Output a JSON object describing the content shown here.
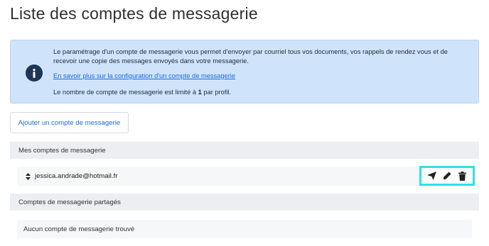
{
  "page": {
    "title": "Liste des comptes de messagerie"
  },
  "info": {
    "description": "Le paramétrage d'un compte de messagerie vous permet d'envoyer par courriel tous vos documents, vos rappels de rendez vous et de recevoir une copie des messages envoyés dans votre messagerie.",
    "link_label": "En savoir plus sur la configuration d'un compte de messagerie",
    "limit_prefix": "Le nombre de compte de messagerie est limité à ",
    "limit_value": "1",
    "limit_suffix": " par profil.",
    "icon": "info-circle-icon"
  },
  "add_button": {
    "label": "Ajouter un compte de messagerie"
  },
  "my_accounts": {
    "header": "Mes comptes de messagerie",
    "items": [
      {
        "email": "jessica.andrade@hotmail.fr",
        "actions": [
          "send-icon",
          "pencil-icon",
          "trash-icon"
        ]
      }
    ]
  },
  "shared_accounts": {
    "header": "Comptes de messagerie partagés",
    "empty_text": "Aucun compte de messagerie trouvé"
  },
  "colors": {
    "info_background": "#cfe3fb",
    "link": "#1b6bd6",
    "highlight": "#2ee0e8",
    "icon_dark": "#1d3557"
  }
}
